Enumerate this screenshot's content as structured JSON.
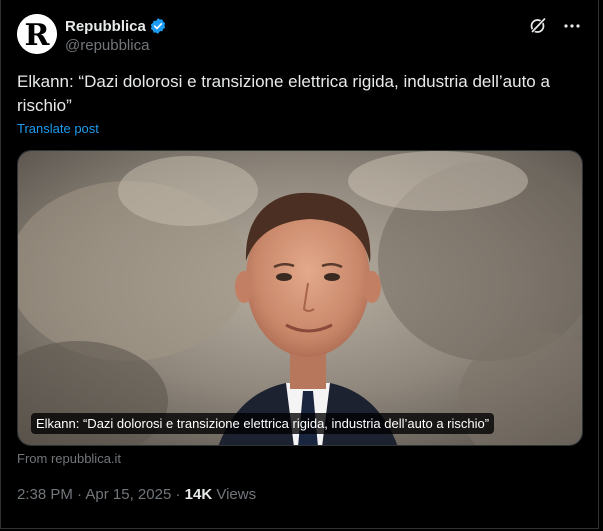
{
  "author": {
    "display_name": "Repubblica",
    "handle": "@repubblica",
    "avatar_letter": "R",
    "verified": true
  },
  "header_icons": [
    "grok-icon",
    "more-icon"
  ],
  "tweet": {
    "text": "Elkann: “Dazi dolorosi e transizione elettrica rigida, industria dell’auto a rischio”",
    "translate_label": "Translate post"
  },
  "card": {
    "image_caption": "Elkann: “Dazi dolorosi e transizione elettrica rigida, industria dell’auto a rischio”",
    "source_label": "From repubblica.it"
  },
  "meta": {
    "time": "2:38 PM",
    "separator": "·",
    "date": "Apr 15, 2025",
    "views_count": "14K",
    "views_label": "Views"
  },
  "colors": {
    "background": "#000000",
    "text": "#e7e9ea",
    "muted": "#71767b",
    "link": "#1d9bf0",
    "verified": "#1d9bf0"
  }
}
